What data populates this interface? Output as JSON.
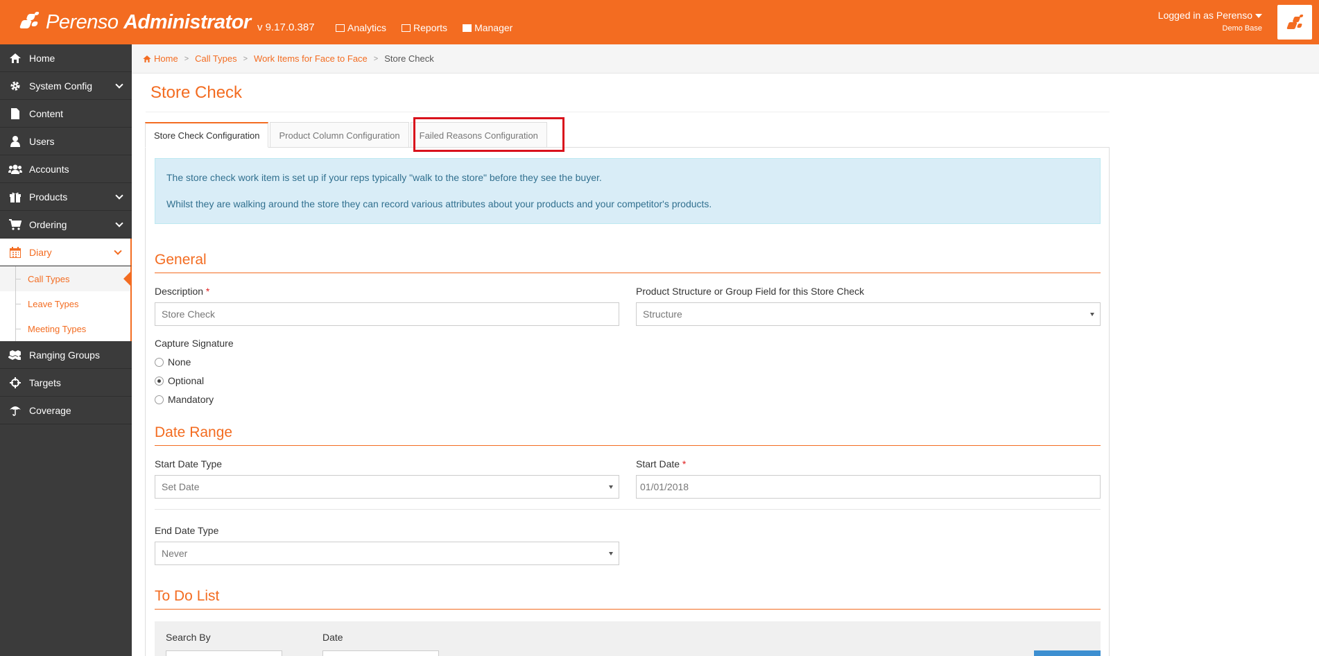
{
  "header": {
    "brand_light": "Perenso",
    "brand_bold": "Administrator",
    "version": "v 9.17.0.387",
    "nav": [
      {
        "label": "Analytics",
        "icon": "chart-icon"
      },
      {
        "label": "Reports",
        "icon": "table-icon"
      },
      {
        "label": "Manager",
        "icon": "briefcase-icon"
      }
    ],
    "logged_in": "Logged in as Perenso",
    "database": "Demo Base"
  },
  "sidebar": {
    "items": [
      {
        "label": "Home",
        "icon": "home-icon"
      },
      {
        "label": "System Config",
        "icon": "gear-icon",
        "expandable": true
      },
      {
        "label": "Content",
        "icon": "file-icon"
      },
      {
        "label": "Users",
        "icon": "user-icon"
      },
      {
        "label": "Accounts",
        "icon": "users-icon"
      },
      {
        "label": "Products",
        "icon": "gift-icon",
        "expandable": true
      },
      {
        "label": "Ordering",
        "icon": "cart-icon",
        "expandable": true
      },
      {
        "label": "Diary",
        "icon": "calendar-icon",
        "expandable": true,
        "active": true
      },
      {
        "label": "Ranging Groups",
        "icon": "cubes-icon"
      },
      {
        "label": "Targets",
        "icon": "crosshairs-icon"
      },
      {
        "label": "Coverage",
        "icon": "umbrella-icon"
      }
    ],
    "diary_sub": [
      {
        "label": "Call Types",
        "current": true
      },
      {
        "label": "Leave Types"
      },
      {
        "label": "Meeting Types"
      }
    ]
  },
  "breadcrumb": {
    "home": "Home",
    "items": [
      "Call Types",
      "Work Items for Face to Face"
    ],
    "current": "Store Check"
  },
  "page": {
    "title": "Store Check",
    "tabs": [
      "Store Check Configuration",
      "Product Column Configuration",
      "Failed Reasons Configuration"
    ],
    "info": [
      "The store check work item is set up if your reps typically \"walk to the store\" before they see the buyer.",
      "Whilst they are walking around the store they can record various attributes about your products and your competitor's products."
    ]
  },
  "general": {
    "heading": "General",
    "description_label": "Description",
    "description_value": "Store Check",
    "structure_label": "Product Structure or Group Field for this Store Check",
    "structure_value": "Structure",
    "signature_label": "Capture Signature",
    "signature_options": [
      "None",
      "Optional",
      "Mandatory"
    ],
    "signature_selected": "Optional"
  },
  "date_range": {
    "heading": "Date Range",
    "start_type_label": "Start Date Type",
    "start_type_value": "Set Date",
    "start_date_label": "Start Date",
    "start_date_value": "01/01/2018",
    "end_type_label": "End Date Type",
    "end_type_value": "Never"
  },
  "todo": {
    "heading": "To Do List",
    "search_by_label": "Search By",
    "date_label": "Date"
  },
  "required_mark": "*",
  "colors": {
    "brand": "#f36c21",
    "sidebar": "#3b3b3b",
    "info_bg": "#d9edf7",
    "highlight": "#d9121c"
  }
}
